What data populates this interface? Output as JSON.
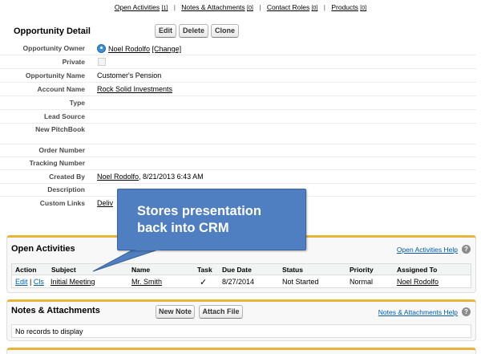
{
  "related_links": {
    "open_activities": {
      "label": "Open Activities",
      "count": "[1]"
    },
    "notes_attachments": {
      "label": "Notes & Attachments",
      "count": "[0]"
    },
    "contact_roles": {
      "label": "Contact Roles",
      "count": "[0]"
    },
    "products": {
      "label": "Products",
      "count": "[0]"
    },
    "separator": "|"
  },
  "detail": {
    "title": "Opportunity Detail",
    "buttons": {
      "edit": "Edit",
      "delete": "Delete",
      "clone": "Clone"
    },
    "fields": {
      "owner_label": "Opportunity Owner",
      "owner_value": "Noel Rodolfo",
      "owner_change": "[Change]",
      "private_label": "Private",
      "name_label": "Opportunity Name",
      "name_value": "Customer's Pension",
      "account_label": "Account Name",
      "account_value": "Rock Solid Investments",
      "type_label": "Type",
      "lead_source_label": "Lead Source",
      "pitchbook_label": "New PitchBook",
      "order_label": "Order Number",
      "tracking_label": "Tracking Number",
      "created_label": "Created By",
      "created_user": "Noel Rodolfo",
      "created_date": ", 8/21/2013 6:43 AM",
      "description_label": "Description",
      "custom_links_label": "Custom Links",
      "custom_links_value": "Deliv"
    }
  },
  "callout": {
    "line1": "Stores presentation",
    "line2": "back into CRM",
    "color": "#4f7fc0"
  },
  "open_activities": {
    "title": "Open Activities",
    "help": "Open Activities Help",
    "help_icon": "?",
    "columns": [
      "Action",
      "Subject",
      "Name",
      "Task",
      "Due Date",
      "Status",
      "Priority",
      "Assigned To"
    ],
    "rows": [
      {
        "edit": "Edit",
        "sep": "|",
        "cls": "Cls",
        "subject": "Initial Meeting",
        "name": "Mr. Smith",
        "task": "✓",
        "due": "8/27/2014",
        "status": "Not Started",
        "priority": "Normal",
        "assigned": "Noel Rodolfo"
      }
    ]
  },
  "notes": {
    "title": "Notes & Attachments",
    "new_note": "New Note",
    "attach_file": "Attach File",
    "help": "Notes & Attachments Help",
    "help_icon": "?",
    "empty": "No records to display"
  },
  "colors": {
    "link": "#015ba7",
    "section_accent": "#e7b53a"
  }
}
